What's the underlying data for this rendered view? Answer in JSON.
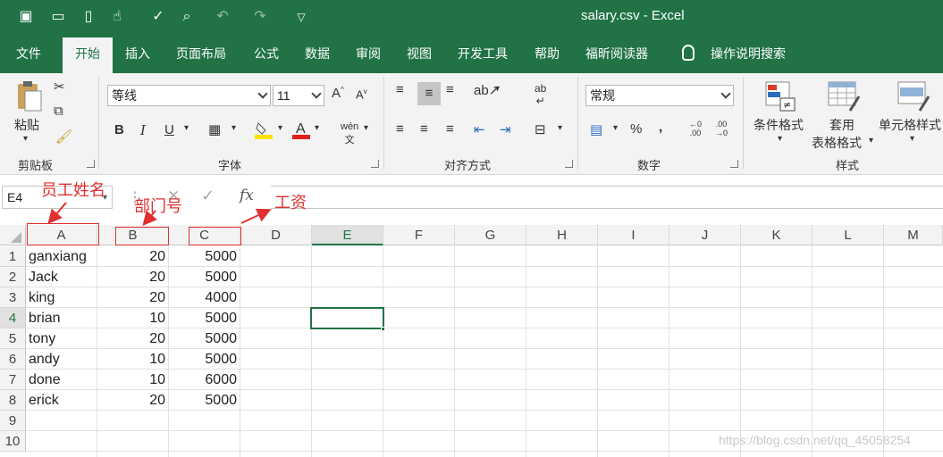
{
  "window": {
    "title": "salary.csv  -  Excel"
  },
  "tabs": [
    "文件",
    "开始",
    "插入",
    "页面布局",
    "公式",
    "数据",
    "审阅",
    "视图",
    "开发工具",
    "帮助",
    "福昕阅读器"
  ],
  "tell_me": "操作说明搜索",
  "ribbon": {
    "clipboard": {
      "paste_label": "粘贴",
      "group_label": "剪贴板"
    },
    "font": {
      "font_name": "等线",
      "font_size": "11",
      "group_label": "字体"
    },
    "alignment": {
      "group_label": "对齐方式"
    },
    "number": {
      "format": "常规",
      "group_label": "数字"
    },
    "styles": {
      "cond_format": "条件格式",
      "table_format_1": "套用",
      "table_format_2": "表格格式",
      "cell_style": "单元格样式",
      "group_label": "样式"
    }
  },
  "formula_bar": {
    "name_box": "E4",
    "fx": "fx",
    "value": ""
  },
  "columns": [
    "A",
    "B",
    "C",
    "D",
    "E",
    "F",
    "G",
    "H",
    "I",
    "J",
    "K",
    "L",
    "M"
  ],
  "rows": [
    "1",
    "2",
    "3",
    "4",
    "5",
    "6",
    "7",
    "8",
    "9",
    "10"
  ],
  "data": [
    [
      "ganxiang",
      "20",
      "5000"
    ],
    [
      "Jack",
      "20",
      "5000"
    ],
    [
      "king",
      "20",
      "4000"
    ],
    [
      "brian",
      "10",
      "5000"
    ],
    [
      "tony",
      "20",
      "5000"
    ],
    [
      "andy",
      "10",
      "5000"
    ],
    [
      "done",
      "10",
      "6000"
    ],
    [
      "erick",
      "20",
      "5000"
    ]
  ],
  "annotations": {
    "a": "员工姓名",
    "b": "部门号",
    "c": "工资"
  },
  "watermark": "https://blog.csdn.net/qq_45058254",
  "colors": {
    "accent": "#217346",
    "annotation": "#e03030"
  }
}
